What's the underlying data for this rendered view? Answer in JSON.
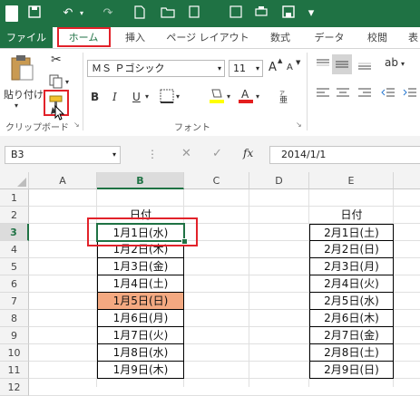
{
  "app": {
    "logo_letter": "X",
    "accent_color": "#1f7244"
  },
  "tabs": {
    "file": "ファイル",
    "home": "ホーム",
    "insert": "挿入",
    "page_layout": "ページ レイアウト",
    "formulas": "数式",
    "data": "データ",
    "review": "校閲",
    "more": "表"
  },
  "ribbon": {
    "paste_label": "貼り付け",
    "clipboard_group": "クリップボード",
    "font_group": "フォント",
    "font_name": "ＭＳ Ｐゴシック",
    "font_size": "11",
    "bold": "B",
    "italic": "I",
    "underline": "U",
    "increase_font": "A",
    "decrease_font": "A",
    "fill_color": "#ffff00",
    "font_color": "#e41e1e"
  },
  "formula_bar": {
    "name_box": "B3",
    "fx": "fx",
    "formula": "2014/1/1"
  },
  "grid": {
    "columns": [
      "A",
      "B",
      "C",
      "D",
      "E"
    ],
    "rows": [
      "1",
      "2",
      "3",
      "4",
      "5",
      "6",
      "7",
      "8",
      "9",
      "10",
      "11",
      "12"
    ],
    "header_b": "日付",
    "header_e": "日付",
    "col_b": [
      "1月1日(水)",
      "1月2日(木)",
      "1月3日(金)",
      "1月4日(土)",
      "1月5日(日)",
      "1月6日(月)",
      "1月7日(火)",
      "1月8日(水)",
      "1月9日(木)"
    ],
    "col_e": [
      "2月1日(土)",
      "2月2日(日)",
      "2月3日(月)",
      "2月4日(火)",
      "2月5日(水)",
      "2月6日(木)",
      "2月7日(金)",
      "2月8日(土)",
      "2月9日(日)"
    ],
    "highlight_color": "#f4a981"
  }
}
